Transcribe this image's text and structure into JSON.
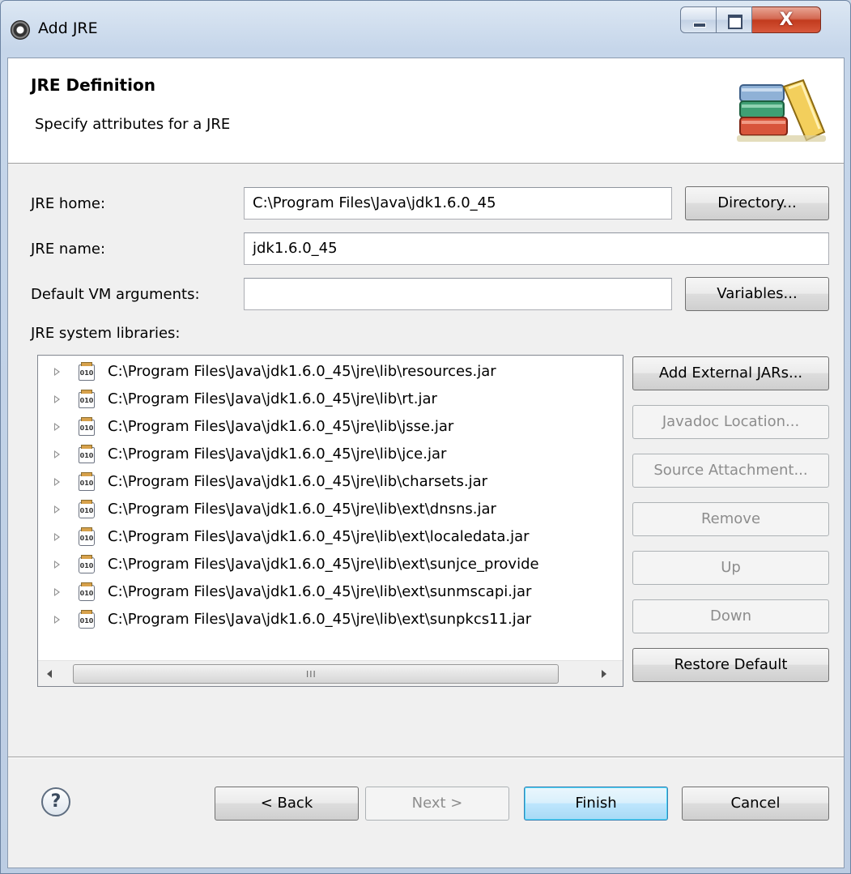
{
  "window": {
    "title": "Add JRE"
  },
  "banner": {
    "title": "JRE Definition",
    "subtitle": "Specify attributes for a JRE",
    "image": "books-icon"
  },
  "form": {
    "jre_home_label": "JRE home:",
    "jre_home_value": "C:\\Program Files\\Java\\jdk1.6.0_45",
    "directory_button": "Directory...",
    "jre_name_label": "JRE name:",
    "jre_name_value": "jdk1.6.0_45",
    "vm_args_label": "Default VM arguments:",
    "vm_args_value": "",
    "variables_button": "Variables...",
    "libraries_label": "JRE system libraries:"
  },
  "libraries": [
    {
      "path": "C:\\Program Files\\Java\\jdk1.6.0_45\\jre\\lib\\resources.jar",
      "icon": "jar-icon"
    },
    {
      "path": "C:\\Program Files\\Java\\jdk1.6.0_45\\jre\\lib\\rt.jar",
      "icon": "jar-icon"
    },
    {
      "path": "C:\\Program Files\\Java\\jdk1.6.0_45\\jre\\lib\\jsse.jar",
      "icon": "jar-icon"
    },
    {
      "path": "C:\\Program Files\\Java\\jdk1.6.0_45\\jre\\lib\\jce.jar",
      "icon": "jar-icon"
    },
    {
      "path": "C:\\Program Files\\Java\\jdk1.6.0_45\\jre\\lib\\charsets.jar",
      "icon": "jar-icon"
    },
    {
      "path": "C:\\Program Files\\Java\\jdk1.6.0_45\\jre\\lib\\ext\\dnsns.jar",
      "icon": "external-jar-icon"
    },
    {
      "path": "C:\\Program Files\\Java\\jdk1.6.0_45\\jre\\lib\\ext\\localedata.jar",
      "icon": "external-jar-icon"
    },
    {
      "path": "C:\\Program Files\\Java\\jdk1.6.0_45\\jre\\lib\\ext\\sunjce_provide",
      "icon": "external-jar-icon"
    },
    {
      "path": "C:\\Program Files\\Java\\jdk1.6.0_45\\jre\\lib\\ext\\sunmscapi.jar",
      "icon": "external-jar-icon"
    },
    {
      "path": "C:\\Program Files\\Java\\jdk1.6.0_45\\jre\\lib\\ext\\sunpkcs11.jar",
      "icon": "external-jar-icon"
    }
  ],
  "library_buttons": {
    "add_external_jars": "Add External JARs...",
    "javadoc_location": "Javadoc Location...",
    "source_attachment": "Source Attachment...",
    "remove": "Remove",
    "up": "Up",
    "down": "Down",
    "restore_default": "Restore Default"
  },
  "footer": {
    "help": "?",
    "back": "< Back",
    "next": "Next >",
    "finish": "Finish",
    "cancel": "Cancel"
  },
  "scrollbar": {
    "grip": "III"
  }
}
